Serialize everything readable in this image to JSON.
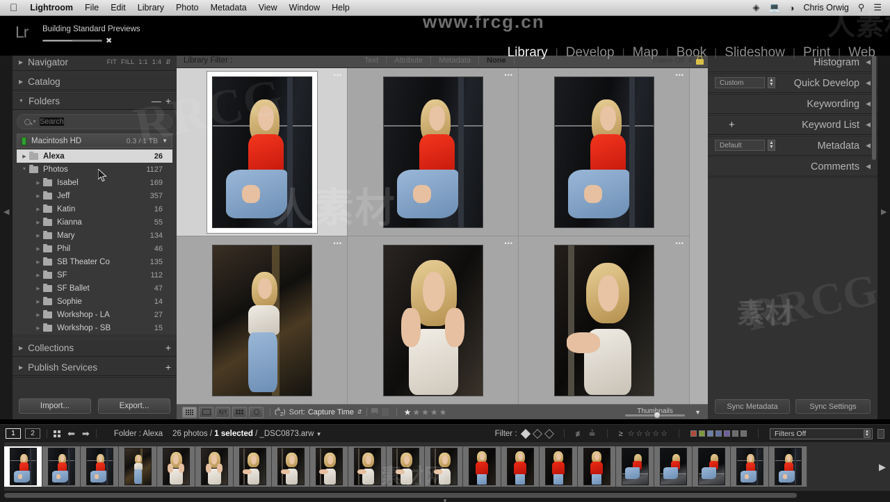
{
  "menubar": {
    "apple_icon": "apple-logo-icon",
    "items": [
      "Lightroom",
      "File",
      "Edit",
      "Library",
      "Photo",
      "Metadata",
      "View",
      "Window",
      "Help"
    ],
    "right": {
      "creative_cloud_icon": "creative-cloud-icon",
      "display_icon": "display-icon",
      "wifi_icon": "wifi-icon",
      "user": "Chris Orwig",
      "search_icon": "spotlight-search-icon",
      "notification_icon": "notification-center-icon"
    }
  },
  "topbar": {
    "logo": "Lr",
    "progress_label": "Building Standard Previews",
    "progress_percent": 50,
    "cancel_icon": "close-icon",
    "modules": [
      {
        "label": "Library",
        "active": true
      },
      {
        "label": "Develop",
        "active": false
      },
      {
        "label": "Map",
        "active": false
      },
      {
        "label": "Book",
        "active": false
      },
      {
        "label": "Slideshow",
        "active": false
      },
      {
        "label": "Print",
        "active": false
      },
      {
        "label": "Web",
        "active": false
      }
    ]
  },
  "watermarks": {
    "url": "www.frcg.cn",
    "rrcg_a": "RRCG",
    "rrcg_b": "RRCG",
    "cn_a": "人素材",
    "cn_b": "素材",
    "cn_c": "人素材",
    "cn_d": "素材网"
  },
  "left_panel": {
    "navigator": {
      "title": "Navigator",
      "zoom_options": [
        "FIT",
        "FILL",
        "1:1",
        "1:4"
      ]
    },
    "catalog": {
      "title": "Catalog"
    },
    "folders": {
      "title": "Folders",
      "minus_label": "—",
      "plus_label": "+",
      "search_placeholder": "Search",
      "volume": {
        "name": "Macintosh HD",
        "size": "0.3 / 1 TB"
      },
      "items": [
        {
          "name": "Alexa",
          "count": "26",
          "selected": true,
          "indent": 0,
          "disclosure": "collapsed"
        },
        {
          "name": "Photos",
          "count": "1127",
          "selected": false,
          "indent": 0,
          "disclosure": "expanded"
        },
        {
          "name": "Isabel",
          "count": "169",
          "selected": false,
          "indent": 1,
          "disclosure": "collapsed"
        },
        {
          "name": "Jeff",
          "count": "357",
          "selected": false,
          "indent": 1,
          "disclosure": "collapsed"
        },
        {
          "name": "Katin",
          "count": "16",
          "selected": false,
          "indent": 1,
          "disclosure": "collapsed"
        },
        {
          "name": "Kianna",
          "count": "55",
          "selected": false,
          "indent": 1,
          "disclosure": "collapsed"
        },
        {
          "name": "Mary",
          "count": "134",
          "selected": false,
          "indent": 1,
          "disclosure": "collapsed"
        },
        {
          "name": "Phil",
          "count": "46",
          "selected": false,
          "indent": 1,
          "disclosure": "collapsed"
        },
        {
          "name": "SB Theater Co",
          "count": "135",
          "selected": false,
          "indent": 1,
          "disclosure": "collapsed"
        },
        {
          "name": "SF",
          "count": "112",
          "selected": false,
          "indent": 1,
          "disclosure": "collapsed"
        },
        {
          "name": "SF Ballet",
          "count": "47",
          "selected": false,
          "indent": 1,
          "disclosure": "collapsed"
        },
        {
          "name": "Sophie",
          "count": "14",
          "selected": false,
          "indent": 1,
          "disclosure": "collapsed"
        },
        {
          "name": "Workshop - LA",
          "count": "27",
          "selected": false,
          "indent": 1,
          "disclosure": "collapsed"
        },
        {
          "name": "Workshop - SB",
          "count": "15",
          "selected": false,
          "indent": 1,
          "disclosure": "collapsed"
        }
      ]
    },
    "collections": {
      "title": "Collections",
      "plus_label": "+"
    },
    "publish_services": {
      "title": "Publish Services",
      "plus_label": "+"
    },
    "import_button": "Import...",
    "export_button": "Export..."
  },
  "library_filter": {
    "label": "Library Filter :",
    "buttons": [
      {
        "label": "Text",
        "active": false
      },
      {
        "label": "Attribute",
        "active": false
      },
      {
        "label": "Metadata",
        "active": false
      },
      {
        "label": "None",
        "active": true
      }
    ],
    "filters_state": "Filters Off",
    "lock_icon": "lock-icon"
  },
  "grid": {
    "cells": [
      {
        "index": 1,
        "selected": true,
        "subject": "red-shirt-sitting"
      },
      {
        "index": 2,
        "selected": false,
        "subject": "red-shirt-sitting"
      },
      {
        "index": 3,
        "selected": false,
        "subject": "red-shirt-sitting"
      },
      {
        "index": 4,
        "selected": false,
        "subject": "white-top-alley"
      },
      {
        "index": 5,
        "selected": false,
        "subject": "white-top-portrait"
      },
      {
        "index": 6,
        "selected": false,
        "subject": "white-top-leaning"
      }
    ],
    "badge_dots": "•••"
  },
  "toolbar": {
    "view_grid_icon": "grid-view-icon",
    "view_loupe_icon": "loupe-view-icon",
    "view_compare_icon": "compare-view-icon",
    "view_survey_icon": "survey-view-icon",
    "people_icon": "people-view-icon",
    "sort_direction_icon": "sort-az-icon",
    "sort_label": "Sort:",
    "sort_value": "Capture Time",
    "flag_icon": "flag-icon",
    "reject_icon": "reject-flag-icon",
    "rating": 1,
    "rating_max": 5,
    "thumbnails_label": "Thumbnails",
    "thumbnail_size_percent": 53,
    "collapse_icon": "chevron-down-icon"
  },
  "right_panel": {
    "sections": [
      {
        "title": "Histogram",
        "preset": null,
        "plus": false
      },
      {
        "title": "Quick Develop",
        "preset": "Custom",
        "plus": false
      },
      {
        "title": "Keywording",
        "preset": null,
        "plus": false
      },
      {
        "title": "Keyword List",
        "preset": null,
        "plus": true
      },
      {
        "title": "Metadata",
        "preset": "Default",
        "plus": false
      },
      {
        "title": "Comments",
        "preset": null,
        "plus": false
      }
    ],
    "sync_metadata_button": "Sync Metadata",
    "sync_settings_button": "Sync Settings"
  },
  "filmstrip_bar": {
    "page_buttons": [
      "1",
      "2"
    ],
    "grid_icon": "grid-icon",
    "back_icon": "arrow-left-icon",
    "forward_icon": "arrow-right-icon",
    "source": "Folder : Alexa",
    "count_text": "26 photos / ",
    "selected_text": "1 selected",
    "filename": " / _DSC0873.arw",
    "dropdown_icon": "chevron-down-icon",
    "filter_label": "Filter :",
    "flag_icons": [
      "flag-pick-icon",
      "flag-neutral-icon",
      "flag-reject-icon"
    ],
    "attribute_icons": [
      "master-photo-icon",
      "virtual-copy-icon"
    ],
    "rating_operator": "≥",
    "rating_stars": 5,
    "color_labels": [
      "#b04a3a",
      "#7e9a3e",
      "#6a7fa8",
      "#5e6fa0",
      "#6e5ea0",
      "#6b6b6b",
      "#6b6b6b"
    ],
    "filters_state": "Filters Off"
  },
  "filmstrip": {
    "selected_index": 0,
    "thumbs": [
      "red-shirt-sitting",
      "red-shirt-sitting",
      "red-shirt-sitting",
      "white-top-alley",
      "white-top-portrait",
      "white-top-portrait",
      "white-top-leaning",
      "white-top-leaning",
      "white-top-leaning",
      "white-top-leaning",
      "white-top-leaning",
      "white-top-leaning",
      "red-shirt-standing",
      "red-shirt-standing",
      "red-shirt-standing",
      "red-shirt-standing",
      "red-shirt-floor",
      "red-shirt-floor",
      "red-shirt-floor",
      "red-shirt-sitting",
      "red-shirt-sitting"
    ],
    "next_icon": "chevron-right-icon"
  }
}
